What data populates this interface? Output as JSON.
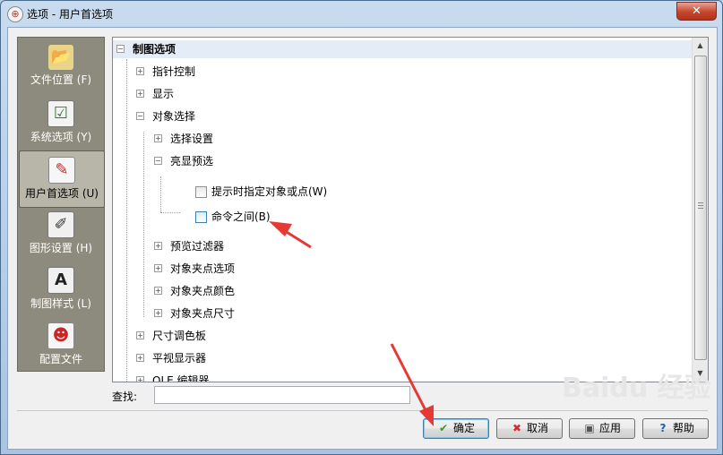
{
  "window": {
    "title": "选项 - 用户首选项",
    "close_glyph": "✕"
  },
  "iconbar": {
    "items": [
      {
        "label": "文件位置 (F)",
        "icon": "folder-arrow-icon",
        "glyph": "📂"
      },
      {
        "label": "系统选项 (Y)",
        "icon": "checklist-icon",
        "glyph": "☑"
      },
      {
        "label": "用户首选项 (U)",
        "icon": "user-pencil-icon",
        "glyph": "✎",
        "selected": true
      },
      {
        "label": "图形设置 (H)",
        "icon": "graphics-settings-icon",
        "glyph": "✐"
      },
      {
        "label": "制图样式 (L)",
        "icon": "drafting-style-icon",
        "glyph": "A"
      },
      {
        "label": "配置文件",
        "icon": "profile-icon",
        "glyph": "☻"
      }
    ]
  },
  "tree": {
    "header": "制图选项",
    "items": {
      "pointer_control": "指针控制",
      "display": "显示",
      "object_selection": "对象选择",
      "selection_settings": "选择设置",
      "highlight_preview": "亮显预选",
      "hint_specify": "提示时指定对象或点(W)",
      "between_commands": "命令之间(B)",
      "preview_filter": "预览过滤器",
      "grip_options": "对象夹点选项",
      "grip_color": "对象夹点颜色",
      "grip_size": "对象夹点尺寸",
      "dim_palette": "尺寸调色板",
      "flat_display": "平视显示器",
      "ole_editor": "OLE 编辑器"
    }
  },
  "search": {
    "label": "查找:",
    "value": ""
  },
  "buttons": {
    "ok": "确定",
    "cancel": "取消",
    "apply": "应用",
    "help": "帮助"
  },
  "watermark": "Baidu 经验",
  "colors": {
    "accent_arrow": "#e53935",
    "iconbar_bg": "#8d8b7d",
    "header_bg": "#e4ecf7"
  }
}
